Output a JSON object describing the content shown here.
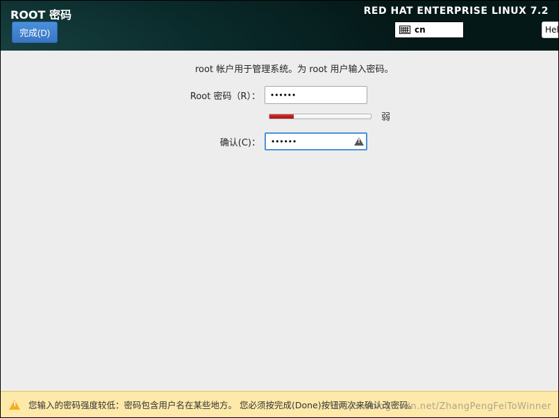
{
  "header": {
    "title": "ROOT 密码",
    "done_label": "完成(D)",
    "distro": "RED HAT ENTERPRISE LINUX 7.2",
    "lang": "cn",
    "help_label": "Hel"
  },
  "form": {
    "instruction": "root 帐户用于管理系统。为 root 用户输入密码。",
    "password_label": "Root 密码（R）：",
    "password_value": "••••••",
    "confirm_label": "确认(C)：",
    "confirm_value": "••••••",
    "strength_text": "弱",
    "strength_percent": 24
  },
  "footer": {
    "message": "您输入的密码强度较低：密码包含用户名在某些地方。 您必须按完成(Done)按钮两次来确认改密码。"
  },
  "watermark": "https://blog.csdn.net/ZhangPengFeiToWinner"
}
